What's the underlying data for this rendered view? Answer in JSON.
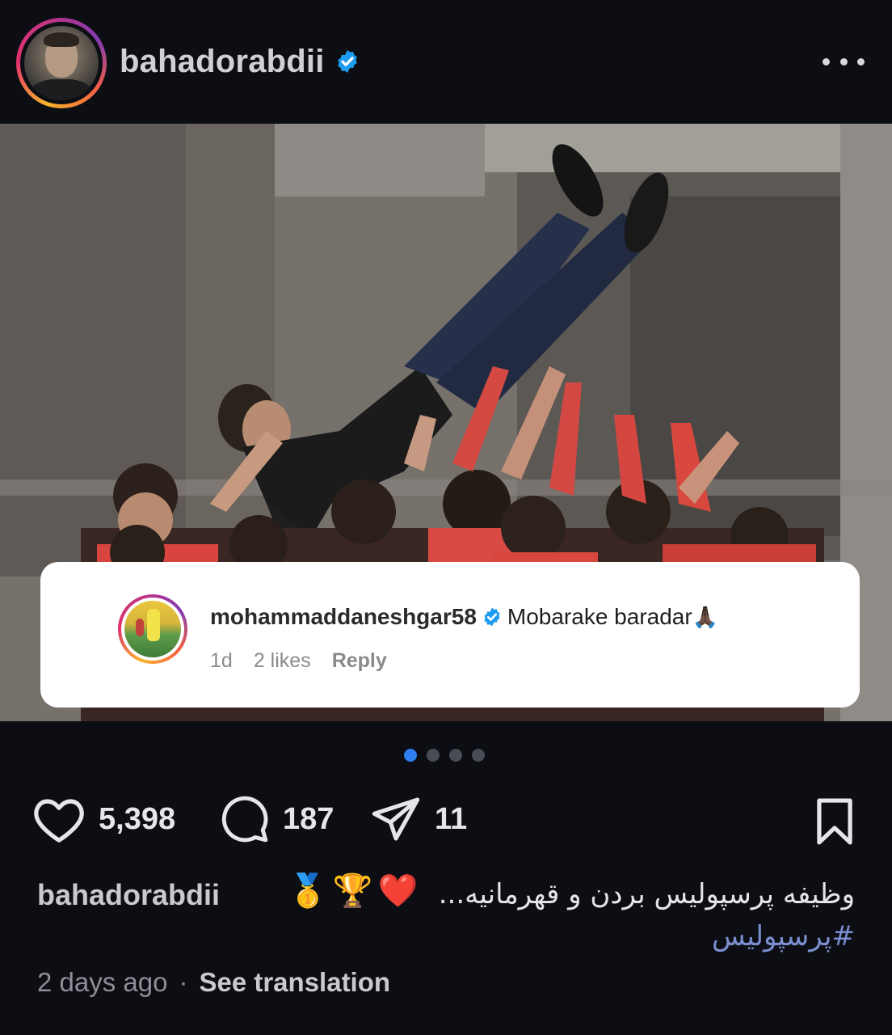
{
  "post": {
    "author": "bahadorabdii",
    "verified": true,
    "more_icon": "more-horizontal-icon"
  },
  "photo": {
    "description_icon": "celebration-photo"
  },
  "comment": {
    "username": "mohammaddaneshgar58",
    "text": "Mobarake baradar",
    "emoji": "🙏🏿",
    "time": "1d",
    "likes": "2 likes",
    "reply_label": "Reply"
  },
  "carousel": {
    "total": 4,
    "active": 1
  },
  "actions": {
    "likes": "5,398",
    "comments": "187",
    "shares": "11"
  },
  "caption": {
    "username": "bahadorabdii",
    "emojis": "🥇🏆❤️",
    "text": "وظیفه پرسپولیس بردن و قهرمانیه...",
    "hashtag": "#پرسپولیس"
  },
  "footer": {
    "time": "2 days ago",
    "separator": "·",
    "translate": "See translation"
  },
  "colors": {
    "background": "#0c0e14",
    "verified": "#1d9bf0",
    "hashtag": "#7b8ed0",
    "dot_active": "#2f7ff0"
  }
}
